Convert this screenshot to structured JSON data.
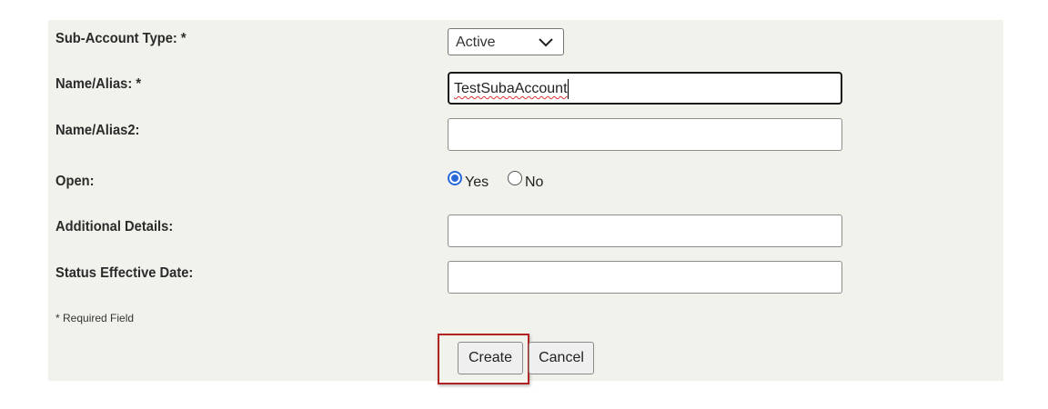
{
  "form": {
    "sub_account_type": {
      "label": "Sub-Account Type: *",
      "selected": "Active"
    },
    "name_alias": {
      "label": "Name/Alias: *",
      "value": "TestSubaAccount"
    },
    "name_alias2": {
      "label": "Name/Alias2:",
      "value": ""
    },
    "open": {
      "label": "Open:",
      "options": [
        "Yes",
        "No"
      ],
      "selected": "Yes"
    },
    "additional_details": {
      "label": "Additional Details:",
      "value": ""
    },
    "status_effective_date": {
      "label": "Status Effective Date:",
      "value": ""
    },
    "required_note": "* Required Field"
  },
  "actions": {
    "create_label": "Create",
    "cancel_label": "Cancel"
  },
  "colors": {
    "panel_bg": "#f2f2ec",
    "radio_accent": "#2a68d8",
    "highlight_border": "#b22222"
  },
  "icons": {
    "select_chevron": "chevron-down-icon"
  }
}
